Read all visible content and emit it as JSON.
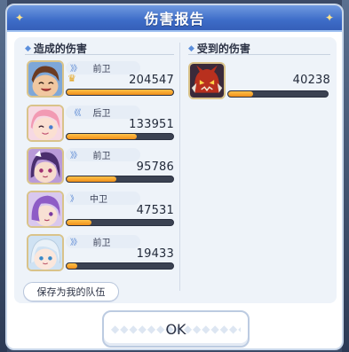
{
  "dialog": {
    "title": "伤害报告"
  },
  "dealt": {
    "heading": "造成的伤害",
    "rows": [
      {
        "role": "前卫",
        "damage": "204547",
        "ratio": 1.0,
        "top": true,
        "avatar": "brown-hair-character-avatar"
      },
      {
        "role": "后卫",
        "damage": "133951",
        "ratio": 0.66,
        "top": false,
        "avatar": "pink-hair-character-avatar"
      },
      {
        "role": "前卫",
        "damage": "95786",
        "ratio": 0.47,
        "top": false,
        "avatar": "purple-hair-character-avatar"
      },
      {
        "role": "中卫",
        "damage": "47531",
        "ratio": 0.23,
        "top": false,
        "avatar": "violet-hair-character-avatar"
      },
      {
        "role": "前卫",
        "damage": "19433",
        "ratio": 0.1,
        "top": false,
        "avatar": "white-hair-character-avatar"
      }
    ]
  },
  "received": {
    "heading": "受到的伤害",
    "rows": [
      {
        "damage": "40238",
        "ratio": 0.25,
        "avatar": "red-monster-avatar"
      }
    ]
  },
  "buttons": {
    "save_team": "保存为我的队伍",
    "ok": "OK"
  },
  "colors": {
    "title_bar": "#3d6cc8",
    "bar_fill": "#f0901a",
    "bar_track": "#3b4252",
    "panel": "#eef3f9"
  }
}
